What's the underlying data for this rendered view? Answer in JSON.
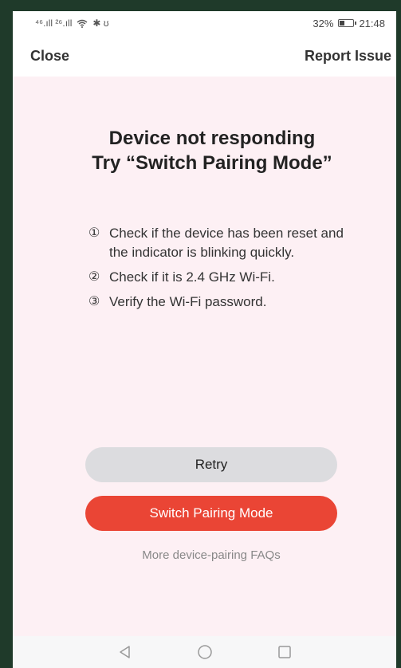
{
  "status_bar": {
    "signal_text": "⁴⁶.ıll ²⁶.ıll",
    "wifi_icon": "wifi-icon",
    "extra_icons": "✱ ʊ",
    "battery_percent": "32%",
    "time": "21:48"
  },
  "header": {
    "close_label": "Close",
    "report_label": "Report Issue"
  },
  "main": {
    "title_line1": "Device not responding",
    "title_line2": "Try “Switch Pairing Mode”",
    "steps": [
      {
        "num": "①",
        "text": "Check if the device has been reset and the indicator is blinking quickly."
      },
      {
        "num": "②",
        "text": "Check if it is 2.4 GHz Wi-Fi."
      },
      {
        "num": "③",
        "text": "Verify the Wi-Fi password."
      }
    ],
    "retry_label": "Retry",
    "switch_label": "Switch Pairing Mode",
    "faq_label": "More device-pairing FAQs"
  },
  "colors": {
    "accent": "#ea4535",
    "background": "#fdf0f4",
    "retry_button": "#dcdcdf"
  }
}
